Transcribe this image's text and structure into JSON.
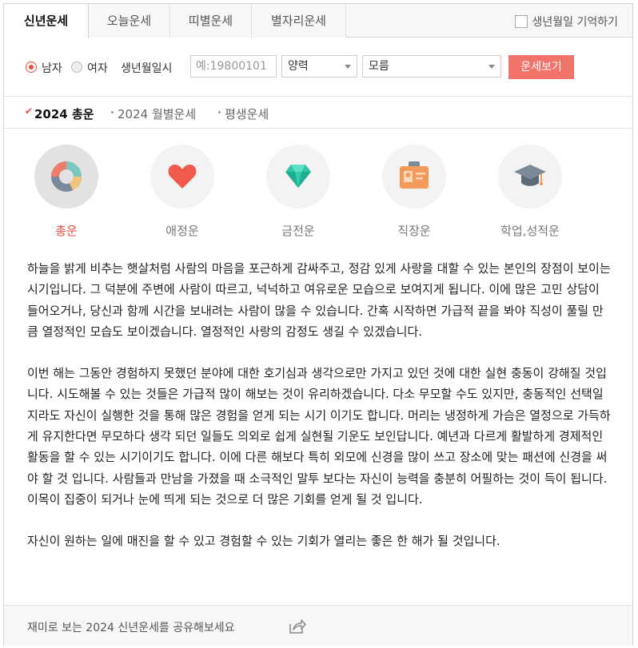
{
  "tabs": [
    {
      "label": "신년운세"
    },
    {
      "label": "오늘운세"
    },
    {
      "label": "띠별운세"
    },
    {
      "label": "별자리운세"
    }
  ],
  "remember_label": "생년월일 기억하기",
  "form": {
    "male": "남자",
    "female": "여자",
    "birth_label": "생년월일시",
    "birth_placeholder": "예:19800101",
    "calendar": "양력",
    "time": "모름",
    "submit": "운세보기"
  },
  "subtabs": {
    "year": "2024 총운",
    "monthly": "2024 월별운세",
    "lifetime": "평생운세"
  },
  "categories": [
    {
      "label": "총운",
      "icon": "donut-chart-icon"
    },
    {
      "label": "애정운",
      "icon": "heart-icon"
    },
    {
      "label": "금전운",
      "icon": "gem-icon"
    },
    {
      "label": "직장운",
      "icon": "id-badge-icon"
    },
    {
      "label": "학업,성적운",
      "icon": "graduation-cap-icon"
    }
  ],
  "paragraphs": [
    "하늘을 밝게 비추는 햇살처럼 사람의 마음을 포근하게 감싸주고, 정감 있게 사랑을 대할 수 있는 본인의 장점이 보이는 시기입니다. 그 덕분에 주변에 사람이 따르고, 넉넉하고 여유로운 모습으로 보여지게 됩니다. 이에 많은 고민 상담이 들어오거나, 당신과 함께 시간을 보내려는 사람이 많을 수 있습니다. 간혹 시작하면 가급적 끝을 봐야 직성이 풀릴 만큼 열정적인 모습도 보이겠습니다. 열정적인 사랑의 감정도 생길 수 있겠습니다.",
    "이번 해는 그동안 경험하지 못했던 분야에 대한 호기심과 생각으로만 가지고 있던 것에 대한 실현 충동이 강해질 것입니다. 시도해볼 수 있는 것들은 가급적 많이 해보는 것이 유리하겠습니다. 다소 무모할 수도 있지만, 충동적인 선택일지라도 자신이 실행한 것을 통해 많은 경험을 얻게 되는 시기 이기도 합니다. 머리는 냉정하게 가슴은 열정으로 가득하게 유지한다면 무모하다 생각 되던 일들도 의외로 쉽게 실현될 기운도 보인답니다. 예년과 다르게 활발하게 경제적인 활동을 할 수 있는 시기이기도 합니다. 이에 다른 해보다 특히 외모에 신경을 많이 쓰고 장소에 맞는 패션에 신경을 써야 할 것 입니다. 사람들과 만남을 가졌을 때 소극적인 말투 보다는 자신이 능력을 충분히 어필하는 것이 득이 됩니다. 이목이 집중이 되거나 눈에 띄게 되는 것으로 더 많은 기회를 얻게 될 것 입니다.",
    "자신이 원하는 일에 매진을 할 수 있고 경험할 수 있는 기회가 열리는 좋은 한 해가 될 것입니다."
  ],
  "footer": {
    "share_text": "재미로 보는 2024 신년운세를 공유해보세요",
    "share_icon": "share-icon"
  },
  "colors": {
    "accent": "#e84c3d",
    "button": "#f2736a"
  }
}
